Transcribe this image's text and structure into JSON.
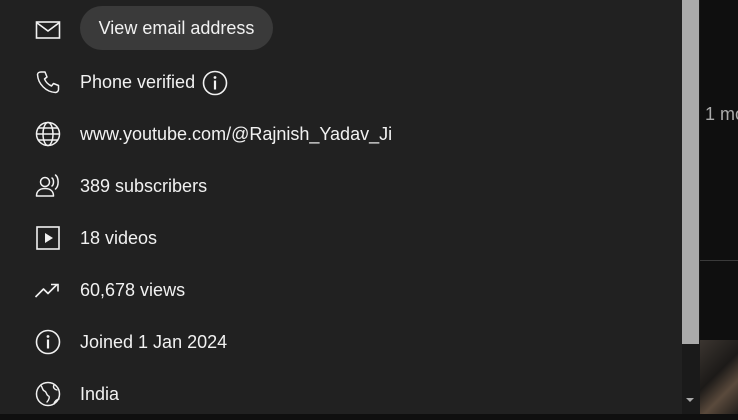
{
  "about_panel": {
    "email_button_label": "View email address",
    "phone_label": "Phone verified",
    "channel_url": "www.youtube.com/@Rajnish_Yadav_Ji",
    "subscribers": "389 subscribers",
    "videos": "18 videos",
    "views": "60,678 views",
    "joined": "Joined 1 Jan 2024",
    "country": "India"
  },
  "background": {
    "snippet_text": "1 mo"
  },
  "icons": {
    "email": "mail-icon",
    "phone": "phone-icon",
    "info": "info-icon",
    "link": "globe-icon",
    "subscribers": "person-radiating-icon",
    "videos": "play-box-icon",
    "views": "trending-up-icon",
    "joined": "info-icon",
    "country": "globe-icon"
  },
  "colors": {
    "panel_bg": "#212121",
    "text": "#f1f1f1",
    "button_bg": "#3a3a3a",
    "scrollbar_thumb": "#aaaaaa"
  }
}
